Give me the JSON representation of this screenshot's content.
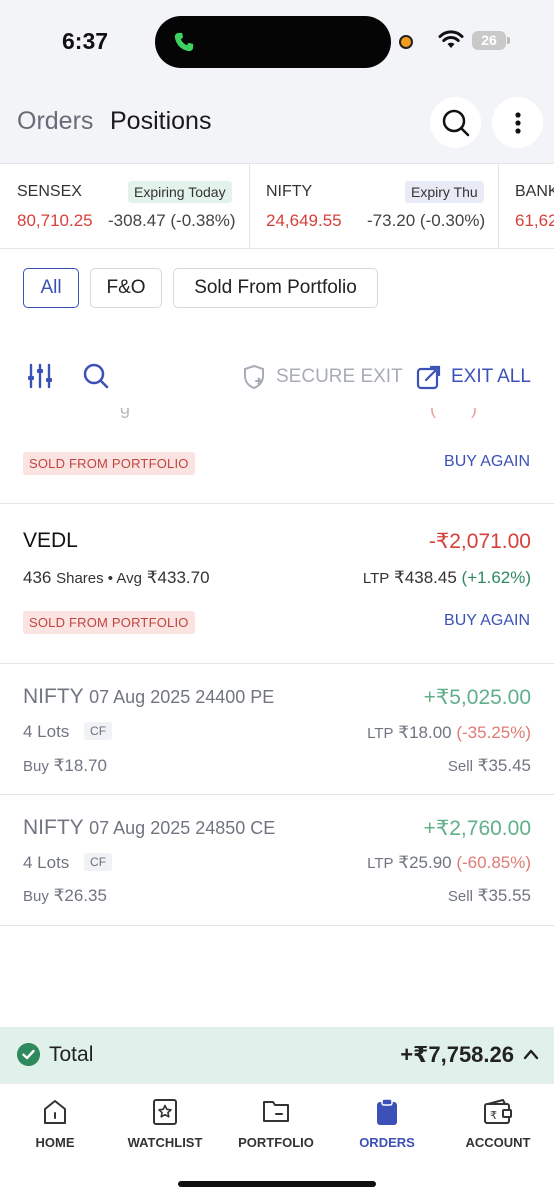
{
  "status": {
    "time": "6:37",
    "battery": "26"
  },
  "header": {
    "tab_orders": "Orders",
    "tab_positions": "Positions"
  },
  "ticker": [
    {
      "name": "SENSEX",
      "badge": "Expiring Today",
      "price": "80,710.25",
      "change": "-308.47 (-0.38%)"
    },
    {
      "name": "NIFTY",
      "badge": "Expiry Thu",
      "price": "24,649.55",
      "change": "-73.20 (-0.30%)"
    },
    {
      "name": "BANK",
      "price": "61,62"
    }
  ],
  "filters": {
    "all": "All",
    "fno": "F&O",
    "sold": "Sold From Portfolio"
  },
  "toolbar": {
    "secure_exit": "SECURE EXIT",
    "exit_all": "EXIT ALL"
  },
  "list": {
    "cut": {
      "tag": "SOLD FROM PORTFOLIO",
      "action": "BUY AGAIN"
    },
    "vedl": {
      "name": "VEDL",
      "pnl": "-₹2,071.00",
      "qty": "436",
      "qty_unit": "Shares • Avg",
      "avg": "₹433.70",
      "ltp_label": "LTP",
      "ltp": "₹438.45",
      "ltp_change": "(+1.62%)",
      "tag": "SOLD FROM PORTFOLIO",
      "action": "BUY AGAIN"
    },
    "opt1": {
      "name": "NIFTY",
      "contract": "07 Aug 2025 24400 PE",
      "pnl": "+₹5,025.00",
      "lots": "4 Lots",
      "cf": "CF",
      "ltp_label": "LTP",
      "ltp": "₹18.00",
      "ltp_change": "(-35.25%)",
      "buy_label": "Buy",
      "buy": "₹18.70",
      "sell_label": "Sell",
      "sell": "₹35.45"
    },
    "opt2": {
      "name": "NIFTY",
      "contract": "07 Aug 2025 24850 CE",
      "pnl": "+₹2,760.00",
      "lots": "4 Lots",
      "cf": "CF",
      "ltp_label": "LTP",
      "ltp": "₹25.90",
      "ltp_change": "(-60.85%)",
      "buy_label": "Buy",
      "buy": "₹26.35",
      "sell_label": "Sell",
      "sell": "₹35.55"
    }
  },
  "total": {
    "label": "Total",
    "value": "+₹7,758.26"
  },
  "nav": {
    "home": "HOME",
    "watchlist": "WATCHLIST",
    "portfolio": "PORTFOLIO",
    "orders": "ORDERS",
    "account": "ACCOUNT"
  },
  "colors": {
    "accent": "#3c51b8",
    "negative": "#d6403a",
    "positive": "#2e8a5e",
    "total_bg": "#e0f0ea"
  }
}
